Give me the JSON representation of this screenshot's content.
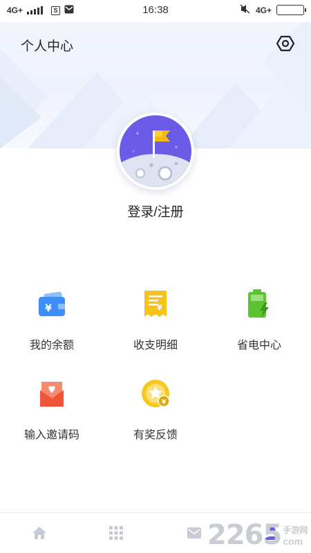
{
  "status_bar": {
    "network_left": "4G+",
    "sim_badge": "S",
    "time": "16:38",
    "network_right": "4G+"
  },
  "header": {
    "title": "个人中心",
    "settings_icon": "settings-hexagon-icon"
  },
  "profile": {
    "avatar_icon": "moon-flag-avatar",
    "login_label": "登录/注册"
  },
  "menu": {
    "items": [
      {
        "label": "我的余额",
        "icon": "wallet-icon",
        "color": "#3d8ef8"
      },
      {
        "label": "收支明细",
        "icon": "receipt-icon",
        "color": "#f7c21a"
      },
      {
        "label": "省电中心",
        "icon": "battery-charge-icon",
        "color": "#5cc431"
      },
      {
        "label": "输入邀请码",
        "icon": "invite-envelope-icon",
        "color": "#f0553a"
      },
      {
        "label": "有奖反馈",
        "icon": "reward-coin-icon",
        "color": "#f5c91f"
      }
    ]
  },
  "bottom_nav": {
    "items": [
      "home-icon",
      "grid-icon",
      "message-icon",
      "user-icon"
    ],
    "active_color": "#6b5ce7"
  },
  "watermark": {
    "digits": "2265",
    "text": "手游网",
    "suffix": "com"
  }
}
